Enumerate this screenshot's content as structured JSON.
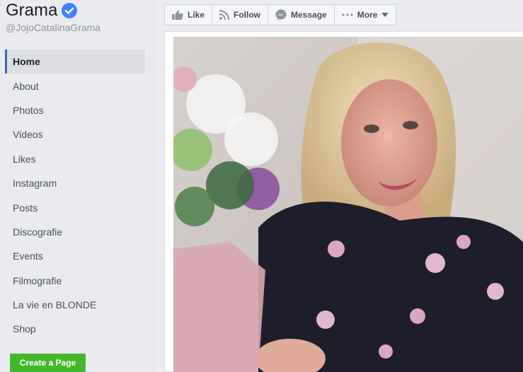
{
  "profile": {
    "name": "Grama",
    "handle": "@JojoCatalinaGrama",
    "verified_icon": "verified-badge-icon"
  },
  "sidebar": {
    "items": [
      {
        "label": "Home",
        "active": true
      },
      {
        "label": "About"
      },
      {
        "label": "Photos"
      },
      {
        "label": "Videos"
      },
      {
        "label": "Likes"
      },
      {
        "label": "Instagram"
      },
      {
        "label": "Posts"
      },
      {
        "label": "Discografie"
      },
      {
        "label": "Events"
      },
      {
        "label": "Filmografie"
      },
      {
        "label": "La vie en BLONDE"
      },
      {
        "label": "Shop"
      }
    ],
    "create_page_label": "Create a Page"
  },
  "actions": {
    "like": {
      "label": "Like",
      "icon": "thumbs-up-icon"
    },
    "follow": {
      "label": "Follow",
      "icon": "rss-icon"
    },
    "message": {
      "label": "Message",
      "icon": "messenger-icon"
    },
    "more": {
      "label": "More",
      "icon": "ellipsis-icon"
    }
  },
  "colors": {
    "sidebar_bg": "#e9ebee",
    "active_accent": "#4267b2",
    "create_button": "#42b72a",
    "verified": "#4080ff"
  }
}
